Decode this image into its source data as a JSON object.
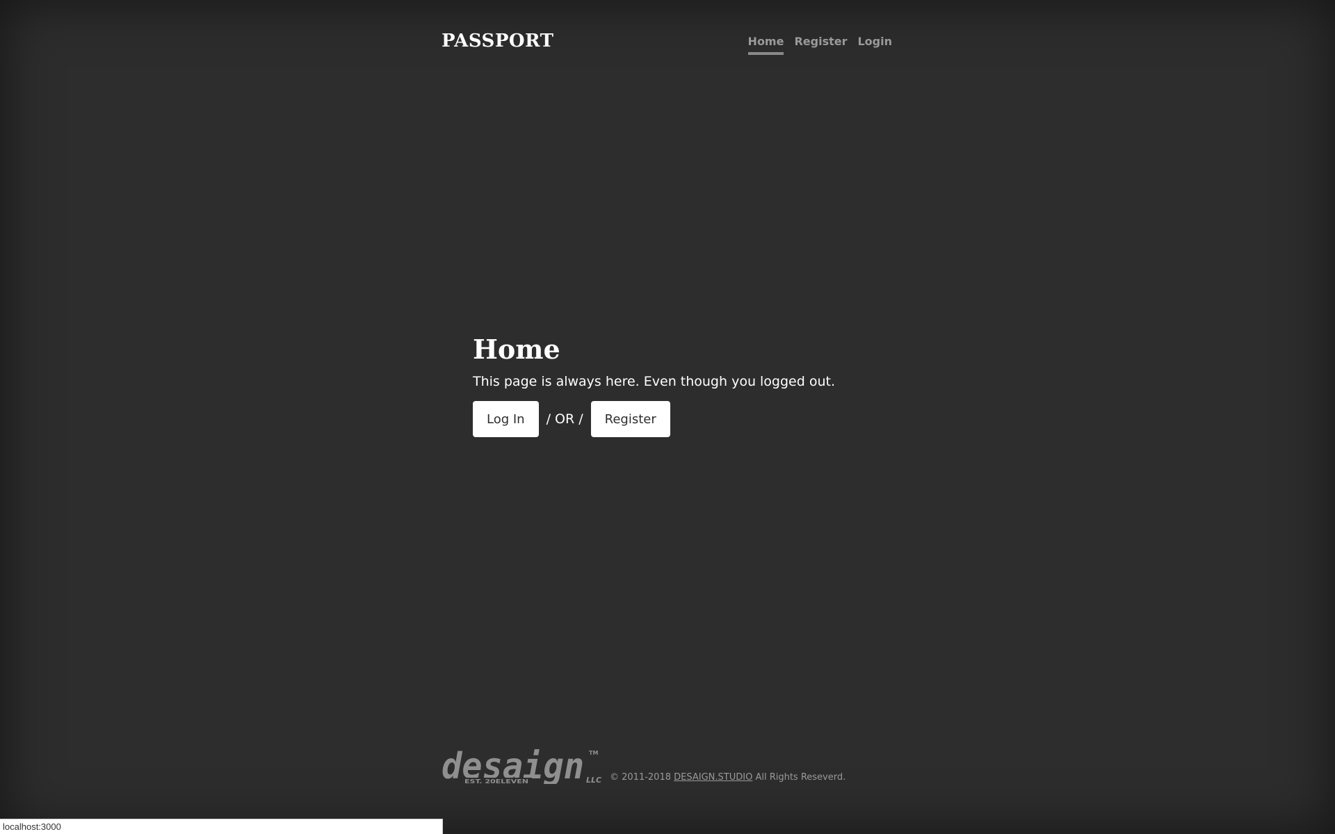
{
  "header": {
    "brand": "PASSPORT",
    "nav": [
      {
        "label": "Home",
        "active": true
      },
      {
        "label": "Register",
        "active": false
      },
      {
        "label": "Login",
        "active": false
      }
    ]
  },
  "main": {
    "title": "Home",
    "description": "This page is always here. Even though you logged out.",
    "login_button": "Log In",
    "separator": "/ OR /",
    "register_button": "Register"
  },
  "footer": {
    "logo_text": "desaign",
    "logo_tagline": "EST. 20ELEVEN",
    "logo_suffix": "LLC",
    "logo_tm": "TM",
    "copyright": "© 2011-2018",
    "link_label": "DESAIGN.STUDIO",
    "rights": "All Rights Reseverd."
  },
  "status_bar": {
    "url": "localhost:3000"
  },
  "colors": {
    "background": "#2d2d2d",
    "text": "#ffffff",
    "muted": "#9a9a9a",
    "button_bg": "#ffffff",
    "logo": "#8f8f8f"
  }
}
